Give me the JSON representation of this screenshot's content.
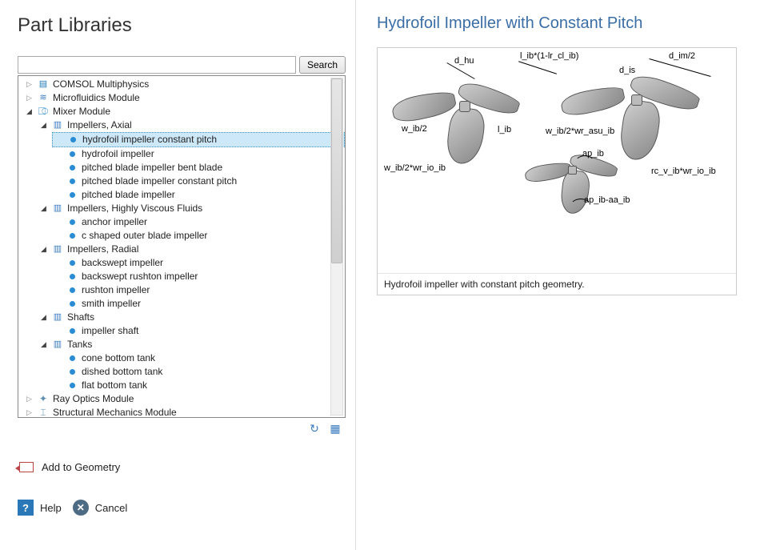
{
  "left": {
    "title": "Part Libraries",
    "search": {
      "value": "",
      "button": "Search"
    },
    "tree": {
      "comsol": "COMSOL Multiphysics",
      "microfluidics": "Microfluidics Module",
      "mixer": "Mixer Module",
      "impellers_axial": "Impellers, Axial",
      "axial_items": [
        "hydrofoil impeller constant pitch",
        "hydrofoil impeller",
        "pitched blade impeller bent blade",
        "pitched blade impeller constant pitch",
        "pitched blade impeller"
      ],
      "impellers_viscous": "Impellers, Highly Viscous Fluids",
      "viscous_items": [
        "anchor impeller",
        "c shaped outer blade impeller"
      ],
      "impellers_radial": "Impellers, Radial",
      "radial_items": [
        "backswept impeller",
        "backswept rushton impeller",
        "rushton impeller",
        "smith impeller"
      ],
      "shafts": "Shafts",
      "shafts_items": [
        "impeller shaft"
      ],
      "tanks": "Tanks",
      "tanks_items": [
        "cone bottom tank",
        "dished bottom tank",
        "flat bottom tank"
      ],
      "ray_optics": "Ray Optics Module",
      "structural": "Structural Mechanics Module"
    },
    "add_to_geometry": "Add to Geometry",
    "help": "Help",
    "cancel": "Cancel"
  },
  "right": {
    "title": "Hydrofoil Impeller with Constant Pitch",
    "annotations": {
      "d_hu": "d_hu",
      "l_ib_expr": "l_ib*(1-lr_cl_ib)",
      "d_im2": "d_im/2",
      "d_is": "d_is",
      "w_ib2": "w_ib/2",
      "l_ib": "l_ib",
      "w_ib2_wr_asu": "w_ib/2*wr_asu_ib",
      "w_ib2_wr_io": "w_ib/2*wr_io_ib",
      "ap_ib": "ap_ib",
      "rc_v_expr": "rc_v_ib*wr_io_ib",
      "ap_ib_aa": "ap_ib-aa_ib"
    },
    "description": "Hydrofoil impeller with constant pitch geometry."
  }
}
